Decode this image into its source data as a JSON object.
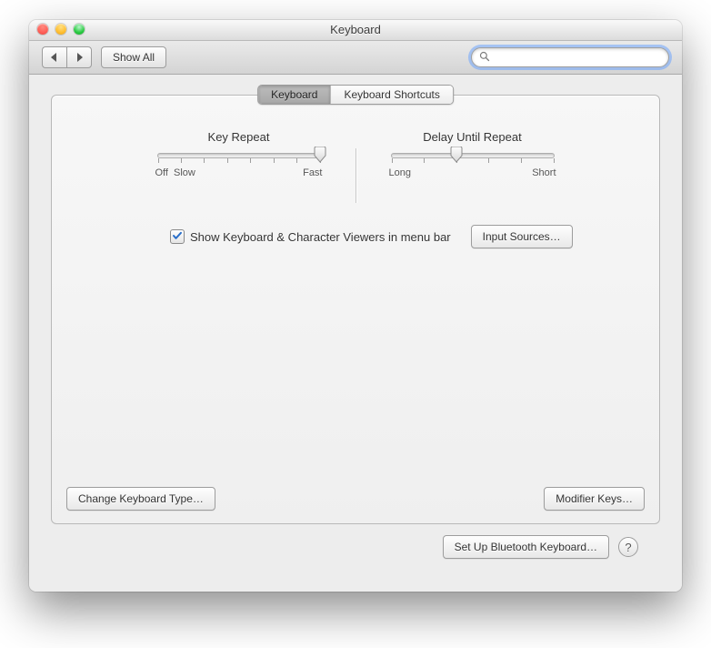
{
  "window": {
    "title": "Keyboard"
  },
  "toolbar": {
    "show_all_label": "Show All",
    "search_placeholder": ""
  },
  "tabs": {
    "keyboard": "Keyboard",
    "shortcuts": "Keyboard Shortcuts",
    "active": "keyboard"
  },
  "sliders": {
    "key_repeat": {
      "label": "Key Repeat",
      "min_label": "Off",
      "mid_label": "Slow",
      "max_label": "Fast",
      "ticks": 8,
      "value": 7
    },
    "delay_until_repeat": {
      "label": "Delay Until Repeat",
      "min_label": "Long",
      "max_label": "Short",
      "ticks": 6,
      "value": 2
    }
  },
  "checkbox": {
    "show_viewers_label": "Show Keyboard & Character Viewers in menu bar",
    "checked": true
  },
  "buttons": {
    "input_sources": "Input Sources…",
    "change_keyboard_type": "Change Keyboard Type…",
    "modifier_keys": "Modifier Keys…",
    "bluetooth": "Set Up Bluetooth Keyboard…"
  }
}
